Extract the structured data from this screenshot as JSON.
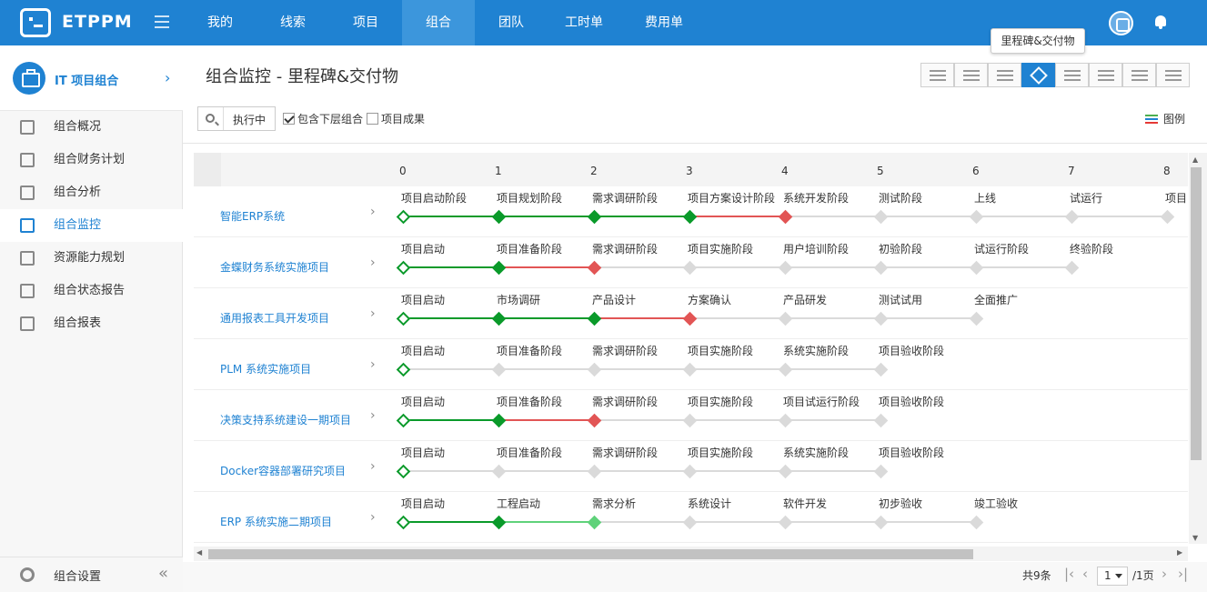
{
  "header": {
    "brand": "ETPPM",
    "nav": [
      "我的",
      "线索",
      "项目",
      "组合",
      "团队",
      "工时单",
      "费用单"
    ],
    "active_nav": 3
  },
  "sidebar": {
    "portfolio_title": "IT 项目组合",
    "items": [
      {
        "label": "组合概况",
        "icon": "grid-icon"
      },
      {
        "label": "组合财务计划",
        "icon": "finance-icon"
      },
      {
        "label": "组合分析",
        "icon": "chart-board-icon"
      },
      {
        "label": "组合监控",
        "icon": "monitor-table-icon",
        "active": true
      },
      {
        "label": "资源能力规划",
        "icon": "resource-compass-icon"
      },
      {
        "label": "组合状态报告",
        "icon": "report-clipboard-icon"
      },
      {
        "label": "组合报表",
        "icon": "bar-report-icon"
      }
    ],
    "settings_label": "组合设置"
  },
  "main": {
    "title": "组合监控 - 里程碑&交付物",
    "tooltip": "里程碑&交付物",
    "toolbar_icons": [
      "list-view-icon",
      "gantt-view-icon",
      "task-view-icon",
      "milestone-view-icon",
      "progress-view-icon",
      "lightning-icon",
      "alert-icon",
      "camera-icon"
    ],
    "active_tool": 3,
    "filter": {
      "status_value": "执行中",
      "include_sub_label": "包含下层组合",
      "include_sub_checked": true,
      "project_results_label": "项目成果",
      "project_results_checked": false
    },
    "legend_label": "图例"
  },
  "colors": {
    "done": "#0a9a2a",
    "late": "#e25555",
    "partial": "#5fd27a",
    "pending": "#dadada",
    "accent": "#1f82d2"
  },
  "grid": {
    "columns": [
      "0",
      "1",
      "2",
      "3",
      "4",
      "5",
      "6",
      "7",
      "8"
    ],
    "rows": [
      {
        "name": "智能ERP系统",
        "milestones": [
          "项目启动阶段",
          "项目规划阶段",
          "需求调研阶段",
          "项目方案设计阶段",
          "系统开发阶段",
          "测试阶段",
          "上线",
          "试运行",
          "项目"
        ],
        "status": [
          "start",
          "done",
          "done",
          "done",
          "late",
          "pending",
          "pending",
          "pending",
          "pending"
        ],
        "links": [
          "done",
          "done",
          "done",
          "late",
          "pending",
          "pending",
          "pending",
          "pending"
        ]
      },
      {
        "name": "金蝶财务系统实施项目",
        "milestones": [
          "项目启动",
          "项目准备阶段",
          "需求调研阶段",
          "项目实施阶段",
          "用户培训阶段",
          "初验阶段",
          "试运行阶段",
          "终验阶段"
        ],
        "status": [
          "start",
          "done",
          "late",
          "pending",
          "pending",
          "pending",
          "pending",
          "pending"
        ],
        "links": [
          "done",
          "late",
          "pending",
          "pending",
          "pending",
          "pending",
          "pending"
        ]
      },
      {
        "name": "通用报表工具开发项目",
        "milestones": [
          "项目启动",
          "市场调研",
          "产品设计",
          "方案确认",
          "产品研发",
          "测试试用",
          "全面推广"
        ],
        "status": [
          "start",
          "done",
          "done",
          "late",
          "pending",
          "pending",
          "pending"
        ],
        "links": [
          "done",
          "done",
          "late",
          "pending",
          "pending",
          "pending"
        ]
      },
      {
        "name": "PLM 系统实施项目",
        "milestones": [
          "项目启动",
          "项目准备阶段",
          "需求调研阶段",
          "项目实施阶段",
          "系统实施阶段",
          "项目验收阶段"
        ],
        "status": [
          "start",
          "pending",
          "pending",
          "pending",
          "pending",
          "pending"
        ],
        "links": [
          "pending",
          "pending",
          "pending",
          "pending",
          "pending"
        ]
      },
      {
        "name": "决策支持系统建设一期项目",
        "milestones": [
          "项目启动",
          "项目准备阶段",
          "需求调研阶段",
          "项目实施阶段",
          "项目试运行阶段",
          "项目验收阶段"
        ],
        "status": [
          "start",
          "done",
          "late",
          "pending",
          "pending",
          "pending"
        ],
        "links": [
          "done",
          "late",
          "pending",
          "pending",
          "pending"
        ]
      },
      {
        "name": "Docker容器部署研究项目",
        "milestones": [
          "项目启动",
          "项目准备阶段",
          "需求调研阶段",
          "项目实施阶段",
          "系统实施阶段",
          "项目验收阶段"
        ],
        "status": [
          "start",
          "pending",
          "pending",
          "pending",
          "pending",
          "pending"
        ],
        "links": [
          "pending",
          "pending",
          "pending",
          "pending",
          "pending"
        ]
      },
      {
        "name": "ERP 系统实施二期项目",
        "milestones": [
          "项目启动",
          "工程启动",
          "需求分析",
          "系统设计",
          "软件开发",
          "初步验收",
          "竣工验收"
        ],
        "status": [
          "start",
          "done",
          "partial",
          "pending",
          "pending",
          "pending",
          "pending"
        ],
        "links": [
          "done",
          "partial",
          "pending",
          "pending",
          "pending",
          "pending"
        ]
      }
    ]
  },
  "pager": {
    "total": "共9条",
    "page": "1",
    "of": "/1页"
  }
}
